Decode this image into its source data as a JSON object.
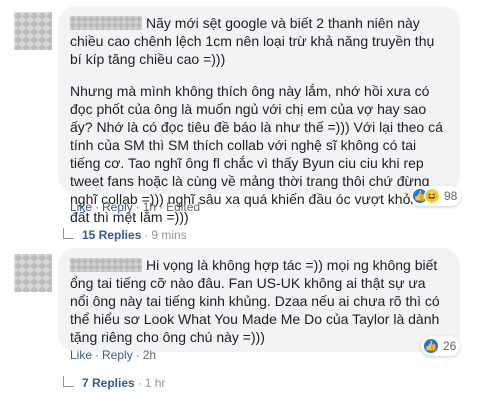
{
  "comments": [
    {
      "paragraphs": [
        "Nãy mới sệt google và biết 2 thanh niên này chiều cao chênh lệch 1cm nên loại trừ khả năng truyền thụ bí kíp tăng chiều cao =)))",
        "Nhưng mà mình không thích ông này lắm, nhớ hồi xưa có đọc phốt của ông là muốn ngủ với chị em của vợ hay sao ấy? Nhớ là có đọc tiêu đề báo là như thế =))) Với lại theo cá tính của SM thì SM thích collab với nghệ sĩ không có tai tiếng cơ. Tao nghĩ ông fl chắc vì thấy Byun ciu ciu khi rep tweet fans hoặc là cùng về mảng thời trang thôi chứ đừng nghĩ collab =))) nghĩ sâu xa quá khiến đầu óc vượt khỏi trái đất thì mệt lắm =)))"
      ],
      "reaction_count": "98",
      "reaction_icons": [
        "like-icon",
        "haha-icon"
      ],
      "actions": {
        "like": "Like",
        "reply": "Reply",
        "time": "1h",
        "edited": "Edited"
      },
      "replies": {
        "count": "15 Replies",
        "time": "9 mins"
      }
    },
    {
      "paragraphs": [
        "Hi vọng là không hợp tác =)) mọi ng không biết ổng tai tiếng cỡ nào đâu. Fan US-UK không ai thật sự ưa nổi ông này tai tiếng kinh khủng. Dzaa nếu ai chưa rõ thì có thể hiểu sơ Look What You Made Me Do của Taylor là dành tặng riêng cho ông chú này =)))"
      ],
      "reaction_count": "26",
      "reaction_icons": [
        "like-icon"
      ],
      "actions": {
        "like": "Like",
        "reply": "Reply",
        "time": "2h"
      },
      "replies": {
        "count": "7 Replies",
        "time": "1 hr"
      }
    }
  ],
  "separator": "·",
  "colors": {
    "link": "#385898",
    "bubble": "#f2f3f5",
    "like": "#1877f2",
    "haha": "#f7d14c"
  }
}
